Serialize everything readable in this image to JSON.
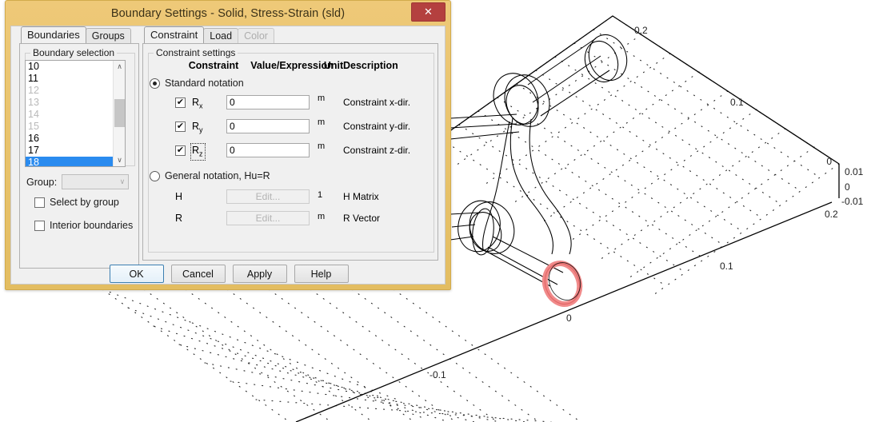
{
  "window": {
    "title": "Boundary Settings - Solid, Stress-Strain (sld)",
    "close_label": "✕",
    "titlebar_color": "#e8c46a",
    "close_color": "#b4403f"
  },
  "left_tabs": [
    {
      "label": "Boundaries",
      "state": "active"
    },
    {
      "label": "Groups",
      "state": "normal"
    }
  ],
  "right_tabs": [
    {
      "label": "Constraint",
      "state": "active"
    },
    {
      "label": "Load",
      "state": "normal"
    },
    {
      "label": "Color",
      "state": "disabled"
    }
  ],
  "boundary_selection": {
    "legend": "Boundary selection",
    "items": [
      {
        "label": "10",
        "state": "normal"
      },
      {
        "label": "11",
        "state": "normal"
      },
      {
        "label": "12",
        "state": "dim"
      },
      {
        "label": "13",
        "state": "dim"
      },
      {
        "label": "14",
        "state": "dim"
      },
      {
        "label": "15",
        "state": "dim"
      },
      {
        "label": "16",
        "state": "normal"
      },
      {
        "label": "17",
        "state": "normal"
      },
      {
        "label": "18",
        "state": "selected"
      }
    ],
    "scroll_up_icon": "∧",
    "scroll_down_icon": "∨",
    "group_label": "Group:",
    "group_value": "",
    "group_chevron_icon": "∨",
    "select_by_group": {
      "label": "Select by group",
      "checked": false
    },
    "interior_boundaries": {
      "label": "Interior boundaries",
      "checked": false
    }
  },
  "constraint_settings": {
    "legend": "Constraint settings",
    "columns": {
      "constraint": "Constraint",
      "value": "Value/Expression",
      "unit": "Unit",
      "description": "Description"
    },
    "standard_notation": {
      "label": "Standard notation",
      "selected": true
    },
    "general_notation": {
      "label": "General notation, Hu=R",
      "selected": false
    },
    "rows": [
      {
        "symbol": "R",
        "sub": "x",
        "checked": true,
        "value": "0",
        "unit": "m",
        "description": "Constraint x-dir.",
        "focused": false
      },
      {
        "symbol": "R",
        "sub": "y",
        "checked": true,
        "value": "0",
        "unit": "m",
        "description": "Constraint y-dir.",
        "focused": false
      },
      {
        "symbol": "R",
        "sub": "z",
        "checked": true,
        "value": "0",
        "unit": "m",
        "description": "Constraint z-dir.",
        "focused": true
      }
    ],
    "general_rows": [
      {
        "symbol": "H",
        "button": "Edit...",
        "unit": "1",
        "description": "H Matrix"
      },
      {
        "symbol": "R",
        "button": "Edit...",
        "unit": "m",
        "description": "R Vector"
      }
    ],
    "checkmark_icon": "✔"
  },
  "buttons": [
    {
      "label": "OK",
      "default": true
    },
    {
      "label": "Cancel",
      "default": false
    },
    {
      "label": "Apply",
      "default": false
    },
    {
      "label": "Help",
      "default": false
    }
  ],
  "viewport": {
    "axis_labels": {
      "x": [
        "-0.1",
        "0",
        "0.1"
      ],
      "y": [
        "0.2",
        "0.1",
        "0"
      ],
      "z": [
        "0.01",
        "0",
        "-0.01"
      ],
      "y_far": "0.2"
    },
    "selected_boundary_color": "#f08a8a",
    "wireframe_color": "#000000",
    "grid_dot_color": "#000000"
  }
}
